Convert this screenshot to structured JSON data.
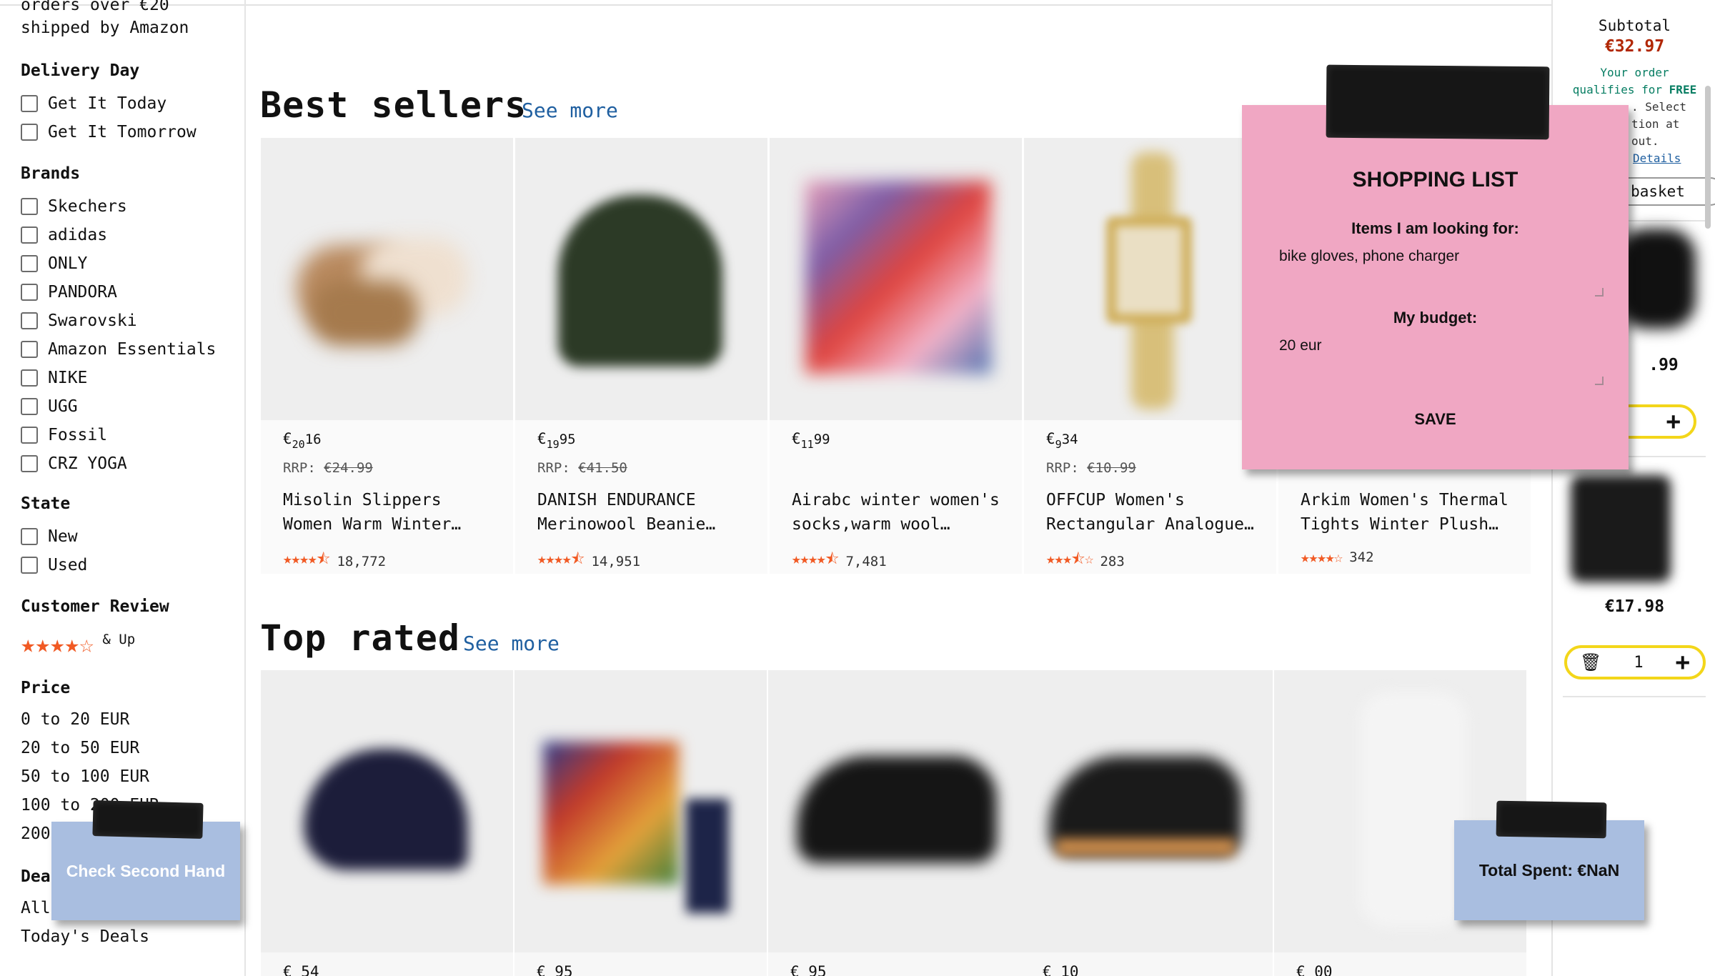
{
  "sidebar": {
    "partial_top_1": "orders over €20",
    "partial_top_2": "shipped by Amazon",
    "delivery_heading": "Delivery Day",
    "delivery_options": [
      "Get It Today",
      "Get It Tomorrow"
    ],
    "brands_heading": "Brands",
    "brands": [
      "Skechers",
      "adidas",
      "ONLY",
      "PANDORA",
      "Swarovski",
      "Amazon Essentials",
      "NIKE",
      "UGG",
      "Fossil",
      "CRZ YOGA"
    ],
    "state_heading": "State",
    "states": [
      "New",
      "Used"
    ],
    "review_heading": "Customer Review",
    "review_rating": 4,
    "review_up": "& Up",
    "price_heading": "Price",
    "prices": [
      "0 to 20 EUR",
      "20 to 50 EUR",
      "50 to 100 EUR",
      "100 to 200 EUR",
      "200"
    ],
    "deals_heading_partial": "Dea",
    "deals": [
      "All",
      "Today's Deals"
    ]
  },
  "best_sellers": {
    "title": "Best sellers",
    "see_more": "See more",
    "products": [
      {
        "price_cur": "€",
        "price_whole": "20",
        "price_frac": "16",
        "rrp_label": "RRP:",
        "rrp": "€24.99",
        "title": "Misolin Slippers Women Warm Winter…",
        "stars": 4.5,
        "reviews": "18,772"
      },
      {
        "price_cur": "€",
        "price_whole": "19",
        "price_frac": "95",
        "rrp_label": "RRP:",
        "rrp": "€41.50",
        "title": "DANISH ENDURANCE Merinowool Beanie…",
        "stars": 4.5,
        "reviews": "14,951"
      },
      {
        "price_cur": "€",
        "price_whole": "11",
        "price_frac": "99",
        "rrp_label": "",
        "rrp": "",
        "title": "Airabc winter women's socks,warm wool…",
        "stars": 4.5,
        "reviews": "7,481"
      },
      {
        "price_cur": "€",
        "price_whole": "9",
        "price_frac": "34",
        "rrp_label": "RRP:",
        "rrp": "€10.99",
        "title": "OFFCUP Women's Rectangular Analogue…",
        "stars": 3.5,
        "reviews": "283"
      },
      {
        "price_cur": "",
        "price_whole": "",
        "price_frac": "",
        "rrp_label": "",
        "rrp": "",
        "title": "Arkim Women's Thermal Tights Winter Plush…",
        "stars": 4,
        "reviews": "342"
      }
    ]
  },
  "top_rated": {
    "title": "Top rated",
    "see_more": "See more",
    "partial_prices": [
      "€ 54",
      "€ 95",
      "€ 95",
      "€ 10",
      "€ 00"
    ]
  },
  "cart": {
    "subtotal_label": "Subtotal",
    "subtotal_value": "€32.97",
    "qualify_line1": "Your order",
    "qualify_line2a": "qualifies for",
    "qualify_line2b": "FREE",
    "qualify_line3": ". Select",
    "qualify_line4": "tion at",
    "qualify_line5": "out.",
    "details_link": "Details",
    "basket_button": "basket",
    "item1_price_partial": ".99",
    "item2_price": "€17.98",
    "item2_qty": "1"
  },
  "shopping_note": {
    "title": "SHOPPING LIST",
    "items_label": "Items I am looking for:",
    "items_value": "bike gloves, phone charger",
    "budget_label": "My budget:",
    "budget_value": "20 eur",
    "save_label": "SAVE"
  },
  "second_hand_note": {
    "label": "Check Second Hand"
  },
  "total_note": {
    "label": "Total Spent: €NaN"
  },
  "colors": {
    "accent_link": "#1f5fa0",
    "star": "#f15a24",
    "subtotal_red": "#b12704",
    "free_green": "#067d62",
    "stepper_yellow": "#f3d61a",
    "note_pink": "#f0a7c3",
    "note_blue": "#a9bee0"
  }
}
